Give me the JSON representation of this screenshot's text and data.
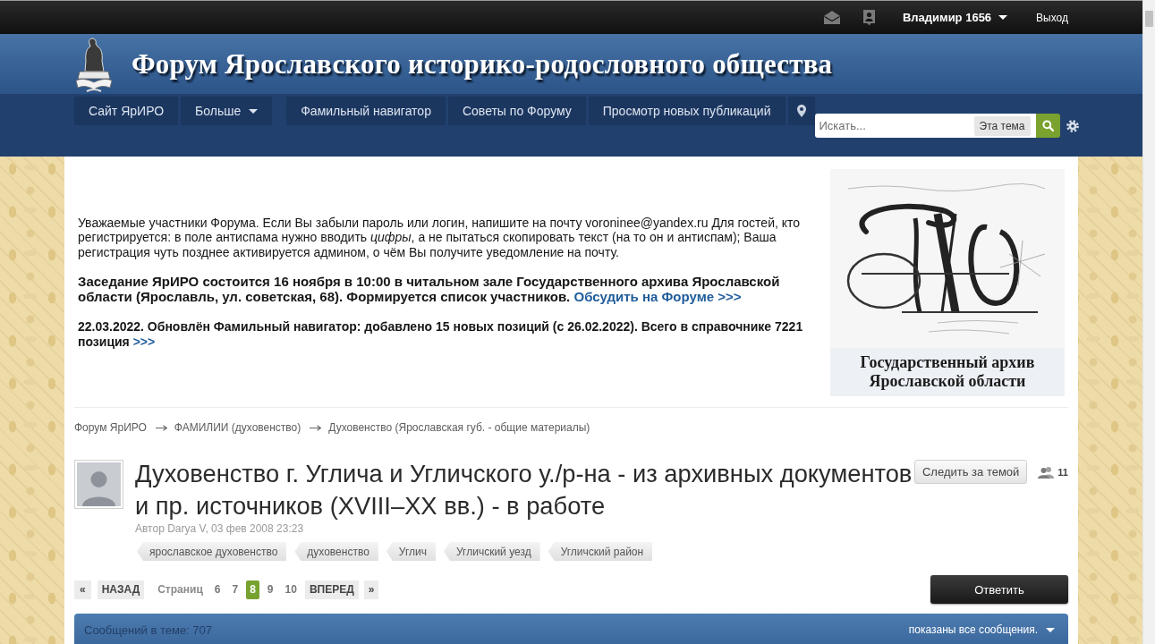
{
  "top_bar": {
    "user_menu": "Владимир 1656",
    "logout": "Выход"
  },
  "header": {
    "site_title": "Форум Ярославского историко-родословного общества"
  },
  "nav": {
    "items": [
      {
        "label": "Сайт ЯрИРО",
        "kind": "link"
      },
      {
        "label": "Больше",
        "kind": "dropdown"
      },
      {
        "label": "Фамильный навигатор",
        "kind": "link"
      },
      {
        "label": "Советы по Форуму",
        "kind": "link"
      },
      {
        "label": "Просмотр новых публикаций",
        "kind": "link"
      }
    ],
    "search": {
      "placeholder": "Искать...",
      "scope": "Эта тема"
    }
  },
  "announcement": {
    "paragraphs": [
      {
        "kind": "notice",
        "text": "Уважаемые участники Форума. Если Вы забыли пароль или логин, напишите на почту voroninee@yandex.ru Для гостей, кто регистрируется: в поле антиспама нужно вводить *цифры*, а не пытаться скопировать текст (на то он и антиспам); Ваша регистрация чуть позднее активируется админом, о чём Вы получите уведомление на почту."
      },
      {
        "kind": "event",
        "text": "Заседание ЯрИРО состоится 16 ноября в 10:00 в читальном зале Государственного архива Ярославской области (Ярославль, ул. советская, 68). Формируется список участников.",
        "link": "Обсудить на Форуме >>>"
      },
      {
        "kind": "news",
        "text": "22.03.2022. Обновлён Фамильный навигатор: добавлено 15 новых позиций (с 26.02.2022). Всего в справочнике 7221 позиция",
        "link": ">>>"
      }
    ],
    "banner_caption": "Государственный архив Ярославской области"
  },
  "breadcrumb": [
    "Форум ЯрИРО",
    "ФАМИЛИИ (духовенство)",
    "Духовенство (Ярославская губ. - общие материалы)"
  ],
  "topic": {
    "title": "Духовенство г. Углича и Угличского у./р-на - из архивных документов и пр. источников (XVIII–XX вв.) - в работе",
    "byline": "Автор Darya V, 03 фев 2008 23:23",
    "follow_button": "Следить за темой",
    "follower_count": "11",
    "tags": [
      "ярославское духовенство",
      "духовенство",
      "Углич",
      "Угличский уезд",
      "Угличский район"
    ]
  },
  "pagination": {
    "first": "«",
    "previous": "НАЗАД",
    "label": "Страниц",
    "pages": [
      {
        "label": "6",
        "selected": false
      },
      {
        "label": "7",
        "selected": false
      },
      {
        "label": "8",
        "selected": true
      },
      {
        "label": "9",
        "selected": false
      },
      {
        "label": "10",
        "selected": false
      }
    ],
    "next": "ВПЕРЕД",
    "last": "»"
  },
  "reply_button": "Ответить",
  "posts_bar": {
    "count": "Сообщений в теме: 707",
    "filter": "показаны все сообщения."
  }
}
